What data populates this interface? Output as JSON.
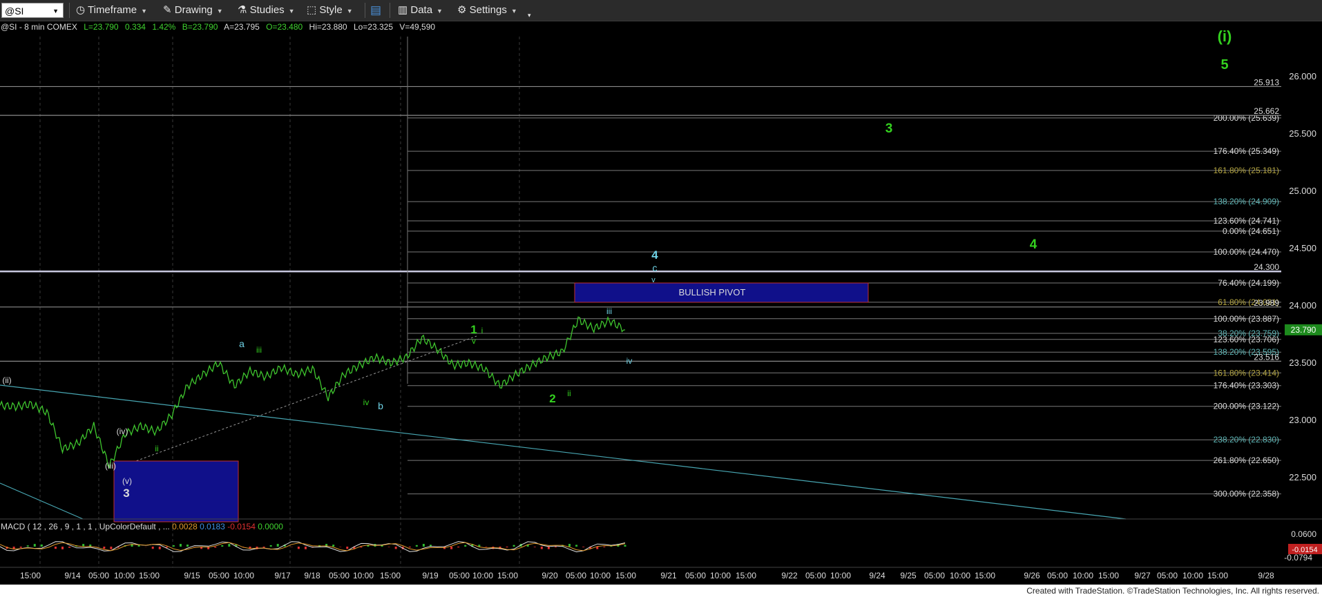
{
  "toolbar": {
    "symbol": "@SI",
    "timeframe": "Timeframe",
    "drawing": "Drawing",
    "studies": "Studies",
    "style": "Style",
    "data": "Data",
    "settings": "Settings"
  },
  "info": {
    "symbol_desc": "@SI - 8 min  COMEX",
    "last": "L=23.790",
    "change": "0.334",
    "change_pct": "1.42%",
    "bid": "B=23.790",
    "ask": "A=23.795",
    "open": "O=23.480",
    "high": "Hi=23.880",
    "low": "Lo=23.325",
    "volume": "V=49,590"
  },
  "colors": {
    "price": "#3fc62e",
    "wave_green": "#34d11f",
    "wave_cyan": "#6fd3e6",
    "pivot": "#10108a",
    "last_badge": "#1d8a1d"
  },
  "chart_data": {
    "type": "line",
    "x_ticks": [
      "15:00",
      "9/14",
      "05:00",
      "10:00",
      "15:00",
      "9/15",
      "05:00",
      "10:00",
      "9/17",
      "9/18",
      "05:00",
      "10:00",
      "15:00",
      "9/19",
      "05:00",
      "10:00",
      "15:00",
      "9/20",
      "05:00",
      "10:00",
      "15:00",
      "9/21",
      "05:00",
      "10:00",
      "15:00",
      "9/22",
      "05:00",
      "10:00",
      "9/24",
      "9/25",
      "05:00",
      "10:00",
      "15:00",
      "9/26",
      "05:00",
      "10:00",
      "15:00",
      "9/27",
      "05:00",
      "10:00",
      "15:00",
      "9/28"
    ],
    "y_ticks": [
      "26.000",
      "25.500",
      "25.000",
      "24.500",
      "24.000",
      "23.500",
      "23.000",
      "22.500"
    ],
    "y_range": [
      22.2,
      26.5
    ],
    "last_price": "23.790",
    "price_points": [
      [
        0,
        23.13
      ],
      [
        1,
        23.12
      ],
      [
        2,
        23.14
      ],
      [
        3,
        23.07
      ],
      [
        4,
        22.75
      ],
      [
        5,
        22.8
      ],
      [
        6,
        22.95
      ],
      [
        7,
        22.6
      ],
      [
        8,
        22.88
      ],
      [
        9,
        22.95
      ],
      [
        10,
        22.9
      ],
      [
        11,
        23.05
      ],
      [
        12,
        23.3
      ],
      [
        13,
        23.4
      ],
      [
        14,
        23.5
      ],
      [
        15,
        23.3
      ],
      [
        16,
        23.43
      ],
      [
        17,
        23.38
      ],
      [
        18,
        23.46
      ],
      [
        19,
        23.4
      ],
      [
        20,
        23.45
      ],
      [
        21,
        23.2
      ],
      [
        22,
        23.4
      ],
      [
        23,
        23.48
      ],
      [
        24,
        23.55
      ],
      [
        25,
        23.5
      ],
      [
        26,
        23.55
      ],
      [
        27,
        23.72
      ],
      [
        28,
        23.62
      ],
      [
        29,
        23.48
      ],
      [
        30,
        23.5
      ],
      [
        31,
        23.45
      ],
      [
        32,
        23.3
      ],
      [
        33,
        23.4
      ],
      [
        34,
        23.48
      ],
      [
        35,
        23.55
      ],
      [
        36,
        23.6
      ],
      [
        37,
        23.88
      ],
      [
        38,
        23.8
      ],
      [
        39,
        23.87
      ],
      [
        40,
        23.79
      ]
    ],
    "fib_labels": [
      {
        "text": "200.00% (25.639)",
        "value": 25.639,
        "color": "#dcdcdc"
      },
      {
        "text": "176.40% (25.349)",
        "value": 25.349,
        "color": "#dcdcdc"
      },
      {
        "text": "161.80% (25.181)",
        "value": 25.181,
        "color": "#b5a642"
      },
      {
        "text": "138.20% (24.909)",
        "value": 24.909,
        "color": "#5fb8b8"
      },
      {
        "text": "123.60% (24.741)",
        "value": 24.741,
        "color": "#dcdcdc"
      },
      {
        "text": "0.00% (24.651)",
        "value": 24.651,
        "color": "#dcdcdc"
      },
      {
        "text": "100.00% (24.470)",
        "value": 24.47,
        "color": "#dcdcdc"
      },
      {
        "text": "76.40% (24.199)",
        "value": 24.199,
        "color": "#dcdcdc"
      },
      {
        "text": "61.80% (24.031)",
        "value": 24.031,
        "color": "#b5a642"
      },
      {
        "text": "100.00% (23.887)",
        "value": 23.887,
        "color": "#dcdcdc"
      },
      {
        "text": "38.20% (23.759)",
        "value": 23.759,
        "color": "#5fb8b8"
      },
      {
        "text": "123.60% (23.706)",
        "value": 23.706,
        "color": "#dcdcdc"
      },
      {
        "text": "138.20% (23.595)",
        "value": 23.595,
        "color": "#5fb8b8"
      },
      {
        "text": "161.80% (23.414)",
        "value": 23.414,
        "color": "#b5a642"
      },
      {
        "text": "176.40% (23.303)",
        "value": 23.303,
        "color": "#dcdcdc"
      },
      {
        "text": "200.00% (23.122)",
        "value": 23.122,
        "color": "#dcdcdc"
      },
      {
        "text": "238.20% (22.830)",
        "value": 22.83,
        "color": "#5fb8b8"
      },
      {
        "text": "261.80% (22.650)",
        "value": 22.65,
        "color": "#dcdcdc"
      },
      {
        "text": "300.00% (22.358)",
        "value": 22.358,
        "color": "#dcdcdc"
      }
    ],
    "level_labels": [
      {
        "text": "25.913",
        "value": 25.913
      },
      {
        "text": "25.662",
        "value": 25.662
      },
      {
        "text": "24.300",
        "value": 24.3
      },
      {
        "text": "23.989",
        "value": 23.989
      },
      {
        "text": "23.516",
        "value": 23.516
      }
    ],
    "pivot_label": "BULLISH PIVOT",
    "wave_labels": [
      {
        "text": "(i)",
        "color": "green",
        "size": "large"
      },
      {
        "text": "5",
        "color": "green",
        "size": "large"
      },
      {
        "text": "3",
        "color": "green",
        "size": "large"
      },
      {
        "text": "4",
        "color": "green",
        "size": "large"
      },
      {
        "text": "4",
        "color": "cyan",
        "size": "large"
      },
      {
        "text": "c",
        "color": "cyan",
        "size": "medium"
      },
      {
        "text": "v",
        "color": "cyan",
        "size": "small"
      },
      {
        "text": "iii",
        "color": "cyan",
        "size": "small"
      },
      {
        "text": "iv",
        "color": "cyan",
        "size": "small"
      },
      {
        "text": "1",
        "color": "green",
        "size": "large"
      },
      {
        "text": "i",
        "color": "green",
        "size": "small"
      },
      {
        "text": "v",
        "color": "green",
        "size": "small"
      },
      {
        "text": "2",
        "color": "green",
        "size": "large"
      },
      {
        "text": "ii",
        "color": "green",
        "size": "small"
      },
      {
        "text": "a",
        "color": "cyan",
        "size": "medium"
      },
      {
        "text": "iii",
        "color": "green",
        "size": "small"
      },
      {
        "text": "iv",
        "color": "green",
        "size": "small"
      },
      {
        "text": "b",
        "color": "cyan",
        "size": "medium"
      },
      {
        "text": "ii",
        "color": "green",
        "size": "small"
      },
      {
        "text": "(iv)",
        "color": "white",
        "size": "small"
      },
      {
        "text": "(iii)",
        "color": "white",
        "size": "small"
      },
      {
        "text": "(v)",
        "color": "white",
        "size": "small"
      },
      {
        "text": "(ii)",
        "color": "white",
        "size": "small"
      },
      {
        "text": "3",
        "color": "white",
        "size": "large"
      }
    ],
    "macd": {
      "label": "MACD ( 12 , 26 , 9 , 1 , 1 , UpColorDefault , ...",
      "v1": "0.0028",
      "v2": "0.0183",
      "v3": "-0.0154",
      "v4": "0.0000",
      "y_ticks": [
        "0.0600",
        "-0.0794"
      ],
      "last": "-0.0154"
    }
  },
  "footer": "Created with TradeStation. ©TradeStation Technologies, Inc. All rights reserved."
}
